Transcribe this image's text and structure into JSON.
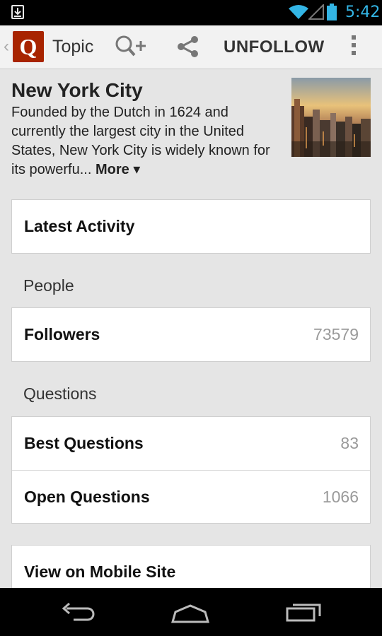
{
  "status_bar": {
    "time": "5:42"
  },
  "action_bar": {
    "logo_letter": "Q",
    "title": "Topic",
    "unfollow_label": "UNFOLLOW"
  },
  "topic": {
    "title": "New York City",
    "description": "Founded by the Dutch in 1624 and currently the largest city in the United States, New York City is widely known for its powerfu...",
    "more_label": "More ▾"
  },
  "latest_activity_label": "Latest Activity",
  "people": {
    "section_label": "People",
    "followers_label": "Followers",
    "followers_count": "73579"
  },
  "questions": {
    "section_label": "Questions",
    "best_label": "Best Questions",
    "best_count": "83",
    "open_label": "Open Questions",
    "open_count": "1066"
  },
  "mobile_site_label": "View on Mobile Site",
  "colors": {
    "accent": "#33b5e5",
    "brand": "#a82400"
  }
}
